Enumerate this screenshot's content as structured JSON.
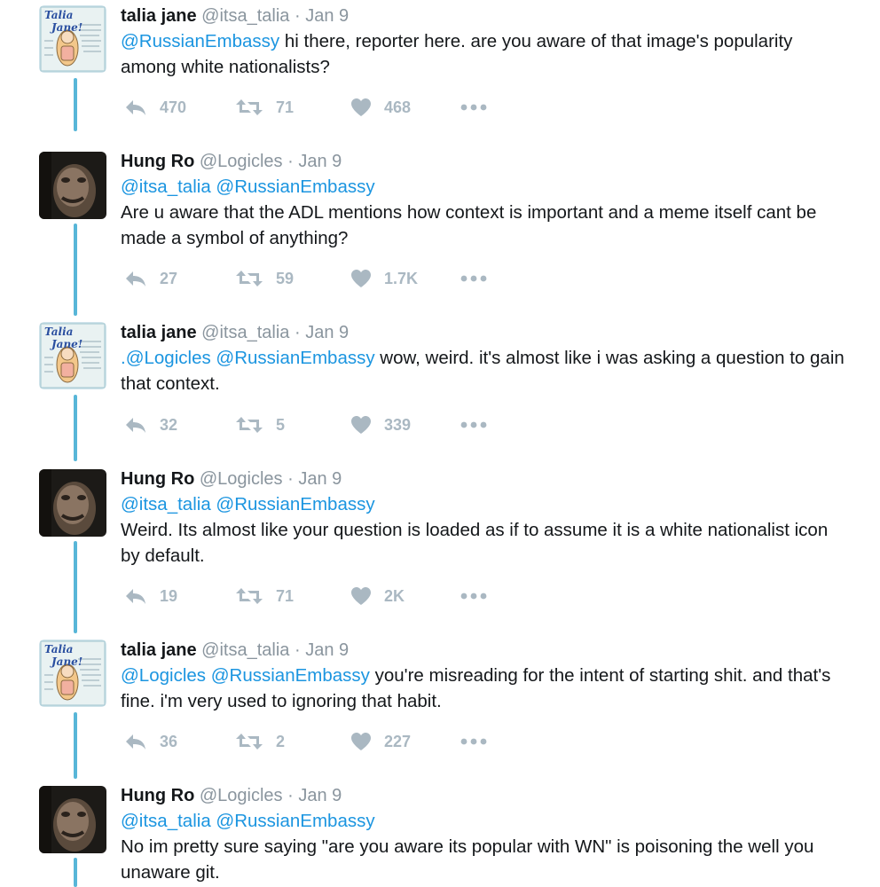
{
  "tweets": [
    {
      "author": "talia",
      "name": "talia jane",
      "handle": "@itsa_talia",
      "sep": "·",
      "date": "Jan 9",
      "mentions": "@RussianEmbassy",
      "text": " hi there, reporter here. are you aware of that image's popularity among white nationalists?",
      "replies": "470",
      "retweets": "71",
      "likes": "468"
    },
    {
      "author": "hung",
      "name": "Hung Ro",
      "handle": "@Logicles",
      "sep": "·",
      "date": "Jan 9",
      "mentions": "@itsa_talia @RussianEmbassy",
      "text": "Are u aware that the ADL mentions how context is important and a meme itself cant be made a symbol of anything?",
      "replies": "27",
      "retweets": "59",
      "likes": "1.7K"
    },
    {
      "author": "talia",
      "name": "talia jane",
      "handle": "@itsa_talia",
      "sep": "·",
      "date": "Jan 9",
      "mentions": ".@Logicles @RussianEmbassy",
      "text": " wow, weird. it's almost like i was asking a question to gain that context.",
      "replies": "32",
      "retweets": "5",
      "likes": "339"
    },
    {
      "author": "hung",
      "name": "Hung Ro",
      "handle": "@Logicles",
      "sep": "·",
      "date": "Jan 9",
      "mentions": "@itsa_talia @RussianEmbassy",
      "text": "Weird. Its almost like your question is loaded as if to assume it is a white nationalist icon by default.",
      "replies": "19",
      "retweets": "71",
      "likes": "2K"
    },
    {
      "author": "talia",
      "name": "talia jane",
      "handle": "@itsa_talia",
      "sep": "·",
      "date": "Jan 9",
      "mentions": "@Logicles @RussianEmbassy",
      "text": " you're misreading for the intent of starting shit. and that's fine. i'm very used to ignoring that habit.",
      "replies": "36",
      "retweets": "2",
      "likes": "227"
    },
    {
      "author": "hung",
      "name": "Hung Ro",
      "handle": "@Logicles",
      "sep": "·",
      "date": "Jan 9",
      "mentions": "@itsa_talia @RussianEmbassy",
      "text": "No im pretty sure saying \"are you aware its popular with WN\" is poisoning the well you unaware git.",
      "replies": "",
      "retweets": "",
      "likes": ""
    }
  ],
  "avatars": {
    "talia": {
      "caption_line1": "Talia",
      "caption_line2": "Jane!"
    },
    "hung": {
      "icon": "user-photo"
    }
  },
  "colors": {
    "link": "#1b95e0",
    "thread_line": "#58b6d8",
    "action_gray": "#aab8c2",
    "secondary_text": "#8a959e"
  }
}
